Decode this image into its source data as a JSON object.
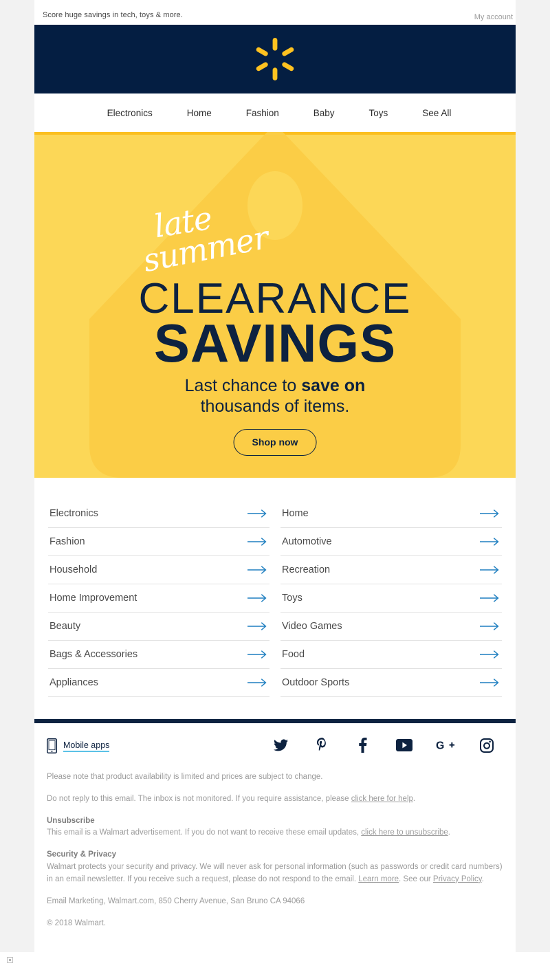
{
  "preheader": {
    "text": "Score huge savings in tech, toys & more.",
    "my_account": "My account"
  },
  "masthead": {
    "logo_name": "walmart-spark-logo",
    "background": "#041e42",
    "spark_color": "#ffc220"
  },
  "nav": {
    "items": [
      {
        "label": "Electronics"
      },
      {
        "label": "Home"
      },
      {
        "label": "Fashion"
      },
      {
        "label": "Baby"
      },
      {
        "label": "Toys"
      },
      {
        "label": "See All"
      }
    ]
  },
  "hero": {
    "script_line1": "late",
    "script_line2": "summer",
    "headline_top": "CLEARANCE",
    "headline_bottom": "SAVINGS",
    "sub_line1_prefix": "Last chance to ",
    "sub_line1_bold": "save on",
    "sub_line2": "thousands of items.",
    "cta_label": "Shop now",
    "background": "#fcd757",
    "tag_color": "#fbcd46",
    "text_color": "#0d2240"
  },
  "categories": {
    "left": [
      {
        "label": "Electronics"
      },
      {
        "label": "Fashion"
      },
      {
        "label": "Household"
      },
      {
        "label": "Home Improvement"
      },
      {
        "label": "Beauty"
      },
      {
        "label": "Bags & Accessories"
      },
      {
        "label": "Appliances"
      }
    ],
    "right": [
      {
        "label": "Home"
      },
      {
        "label": "Automotive"
      },
      {
        "label": "Recreation"
      },
      {
        "label": "Toys"
      },
      {
        "label": "Video Games"
      },
      {
        "label": "Food"
      },
      {
        "label": "Outdoor Sports"
      }
    ],
    "arrow_color": "#1f7fc0"
  },
  "footer": {
    "mobile_apps_label": "Mobile apps",
    "mobile_apps_underline": "#5bc2e7",
    "social": [
      {
        "name": "twitter-icon"
      },
      {
        "name": "pinterest-icon"
      },
      {
        "name": "facebook-icon"
      },
      {
        "name": "youtube-icon"
      },
      {
        "name": "googleplus-icon"
      },
      {
        "name": "instagram-icon"
      }
    ],
    "note_availability": "Please note that product availability is limited and prices are subject to change.",
    "no_reply_prefix": "Do not reply to this email. The inbox is not monitored. If you require assistance, please ",
    "no_reply_link": "click here for help",
    "no_reply_suffix": ".",
    "unsubscribe_heading": "Unsubscribe",
    "unsubscribe_prefix": "This email is a Walmart advertisement. If you do not want to receive these email updates, ",
    "unsubscribe_link": "click here to unsubscribe",
    "unsubscribe_suffix": ".",
    "security_heading": "Security & Privacy",
    "security_body": "Walmart protects your security and privacy. We will never ask for personal information (such as passwords or credit card numbers) in an email newsletter. If you receive such a request, please do not respond to the email. ",
    "learn_more_link": "Learn more",
    "see_our_text": ". See our ",
    "privacy_policy_link": "Privacy Policy",
    "privacy_suffix": ".",
    "address": "Email Marketing, Walmart.com, 850 Cherry Avenue, San Bruno CA 94066",
    "copyright": "© 2018 Walmart."
  }
}
